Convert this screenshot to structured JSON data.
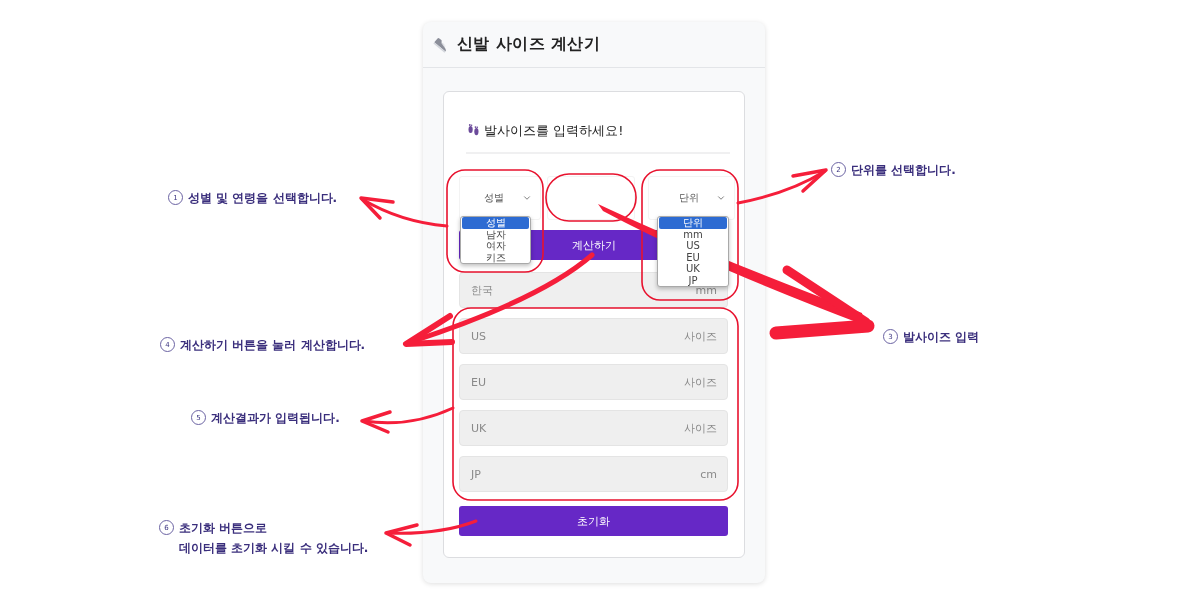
{
  "app": {
    "title": "신발 사이즈 계산기"
  },
  "form": {
    "heading": "발사이즈를 입력하세요!",
    "gender_select": {
      "value": "성별",
      "expanded": true,
      "options": [
        {
          "label": "성별",
          "selected": true
        },
        {
          "label": "남자",
          "selected": false
        },
        {
          "label": "여자",
          "selected": false
        },
        {
          "label": "키즈",
          "selected": false
        }
      ]
    },
    "unit_select": {
      "value": "단위",
      "expanded": true,
      "options": [
        {
          "label": "단위",
          "selected": true
        },
        {
          "label": "mm",
          "selected": false
        },
        {
          "label": "US",
          "selected": false
        },
        {
          "label": "EU",
          "selected": false
        },
        {
          "label": "UK",
          "selected": false
        },
        {
          "label": "JP",
          "selected": false
        }
      ]
    },
    "calculate_button": {
      "label": "계산하기"
    },
    "results": [
      {
        "label": "한국",
        "unit": "mm"
      },
      {
        "label": "US",
        "unit": "사이즈"
      },
      {
        "label": "EU",
        "unit": "사이즈"
      },
      {
        "label": "UK",
        "unit": "사이즈"
      },
      {
        "label": "JP",
        "unit": "cm"
      }
    ],
    "reset_button": {
      "label": "초기화"
    }
  },
  "annotations": [
    {
      "number": "1",
      "text": "성별 및 연령을 선택합니다."
    },
    {
      "number": "2",
      "text": "단위를 선택합니다."
    },
    {
      "number": "3",
      "text": "발사이즈 입력"
    },
    {
      "number": "4",
      "text": "계산하기 버튼을 눌러 계산합니다."
    },
    {
      "number": "5",
      "text": "계산결과가 입력됩니다."
    },
    {
      "number": "6",
      "text": "초기화 버튼으로\n데이터를 초기화 시킬 수 있습니다."
    }
  ]
}
